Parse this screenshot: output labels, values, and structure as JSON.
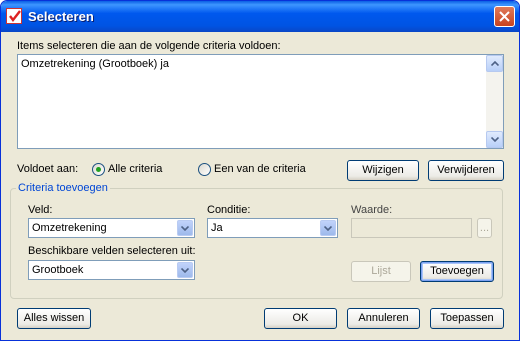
{
  "window": {
    "title": "Selecteren",
    "close_label": "×"
  },
  "criteria_list": {
    "label": "Items selecteren die aan de volgende criteria voldoen:",
    "items": [
      "Omzetrekening (Grootboek) ja"
    ]
  },
  "match": {
    "label": "Voldoet aan:",
    "options": [
      "Alle criteria",
      "Een van de criteria"
    ],
    "selected": "Alle criteria"
  },
  "buttons": {
    "change": "Wijzigen",
    "delete": "Verwijderen",
    "list": "Lijst",
    "add": "Toevoegen",
    "clear_all": "Alles wissen",
    "ok": "OK",
    "cancel": "Annuleren",
    "apply": "Toepassen",
    "ellipsis": "..."
  },
  "add_criteria": {
    "title": "Criteria toevoegen",
    "field_label": "Veld:",
    "field_value": "Omzetrekening",
    "condition_label": "Conditie:",
    "condition_value": "Ja",
    "value_label": "Waarde:",
    "value_value": "",
    "available_label": "Beschikbare velden selecteren uit:",
    "available_value": "Grootboek"
  },
  "colors": {
    "titlebar": "#0054e3",
    "dialog_bg": "#ece9d8",
    "group_title": "#0046d5"
  }
}
